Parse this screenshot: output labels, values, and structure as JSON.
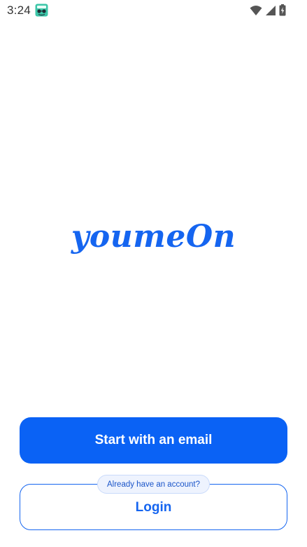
{
  "status_bar": {
    "time": "3:24",
    "icons": [
      "app-notification-icon",
      "wifi-icon",
      "cellular-signal-icon",
      "battery-charging-icon"
    ]
  },
  "logo": {
    "text": "youmeOn"
  },
  "actions": {
    "primary_label": "Start with an email",
    "hint_label": "Already have an account?",
    "secondary_label": "Login"
  },
  "colors": {
    "primary": "#0a62f5",
    "brand_text": "#1565f0",
    "background": "#ffffff"
  }
}
